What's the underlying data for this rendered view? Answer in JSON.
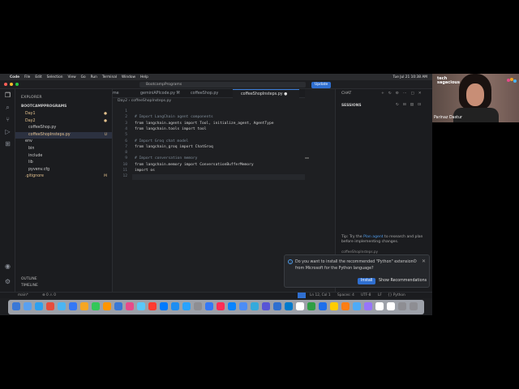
{
  "menubar": {
    "app": "Code",
    "items": [
      "File",
      "Edit",
      "Selection",
      "View",
      "Go",
      "Run",
      "Terminal",
      "Window",
      "Help"
    ],
    "clock": "Tue Jul 21 10:38 AM"
  },
  "titlebar": {
    "search": "BootcampPrograms",
    "update": "Update"
  },
  "explorer": {
    "title": "EXPLORER",
    "root": "BOOTCAMPPROGRAMS",
    "items": [
      {
        "label": "Day1",
        "badge": "●",
        "indent": 0
      },
      {
        "label": "Day2",
        "badge": "●",
        "indent": 0
      },
      {
        "label": "coffeeShop.py",
        "badge": "",
        "indent": 1
      },
      {
        "label": "coffeeShopInsteps.py",
        "badge": "U",
        "indent": 1
      },
      {
        "label": "env",
        "badge": "",
        "indent": 0
      },
      {
        "label": "bin",
        "badge": "",
        "indent": 1
      },
      {
        "label": "include",
        "badge": "",
        "indent": 1
      },
      {
        "label": "lib",
        "badge": "",
        "indent": 1
      },
      {
        "label": "pyvenv.cfg",
        "badge": "",
        "indent": 1
      },
      {
        "label": ".gitignore",
        "badge": "M",
        "indent": 0
      }
    ],
    "outline": "OUTLINE",
    "timeline": "TIMELINE"
  },
  "tabs": [
    {
      "label": "me",
      "active": false
    },
    {
      "label": "geminiAPIcode.py  M",
      "active": false
    },
    {
      "label": "coffeeShop.py",
      "active": false
    },
    {
      "label": "coffeeShopInsteps.py  ●",
      "active": true
    }
  ],
  "breadcrumb": "Day2 › coffeeShopInsteps.py",
  "code": [
    {
      "n": "1",
      "t": "",
      "c": "tx"
    },
    {
      "n": "2",
      "t": "# Import LangChain agent components",
      "c": "cm"
    },
    {
      "n": "3",
      "t": "from langchain.agents import Tool, initialize_agent, AgentType",
      "c": "tx"
    },
    {
      "n": "4",
      "t": "from langchain.tools import tool",
      "c": "tx"
    },
    {
      "n": "5",
      "t": "",
      "c": "tx"
    },
    {
      "n": "6",
      "t": "# Import Groq chat model",
      "c": "cm"
    },
    {
      "n": "7",
      "t": "from langchain_groq import ChatGroq",
      "c": "tx"
    },
    {
      "n": "8",
      "t": "",
      "c": "tx"
    },
    {
      "n": "9",
      "t": "# Import conversation memory",
      "c": "cm"
    },
    {
      "n": "10",
      "t": "from langchain.memory import ConversationBufferMemory",
      "c": "tx"
    },
    {
      "n": "11",
      "t": "import os",
      "c": "tx"
    },
    {
      "n": "12",
      "t": "",
      "c": "tx"
    }
  ],
  "chat": {
    "header": "CHAT",
    "sessions": "SESSIONS",
    "tip_prefix": "Tip: Try the ",
    "tip_link": "Plan agent",
    "tip_suffix": " to research and plan before implementing changes.",
    "file_chip": "coffeeShopInsteps.py"
  },
  "notification": {
    "message": "Do you want to install the recommended \"Python\" extension from Microsoft for the Python language?",
    "install": "Install",
    "show": "Show Recommendations"
  },
  "statusbar": {
    "branch": "main*",
    "errors": "⊗ 0 ⚠ 0",
    "position": "Ln 12, Col 1",
    "spaces": "Spaces: 4",
    "encoding": "UTF-8",
    "eol": "LF",
    "language": "{} Python"
  },
  "webcam": {
    "logo": "tech sagacious",
    "name": "Parinaz Dastur"
  },
  "colors": {
    "accent": "#2f6fd0",
    "editor_bg": "#1e1f22",
    "sidebar_bg": "#1b1c1f",
    "modified": "#e2c08d"
  },
  "dock_icon_colors": [
    "#3a78d6",
    "#5aa0f0",
    "#2ea0f0",
    "#e74c3c",
    "#4bb5f3",
    "#3478f6",
    "#f5a623",
    "#34c759",
    "#ff9500",
    "#3a78d6",
    "#e84a8a",
    "#5ac8fa",
    "#ff3b30",
    "#007aff",
    "#1f8ef1",
    "#29a3ff",
    "#8e8e93",
    "#3478f6",
    "#ff2d55",
    "#0a84ff",
    "#4c8df6",
    "#34aadc",
    "#5856d6",
    "#2f6fd0",
    "#007acc",
    "#ffffff",
    "#2f9e44",
    "#1f6feb",
    "#ffcc00",
    "#fd7e14",
    "#4dabf7",
    "#9775fa",
    "#ffffff",
    "#ffffff",
    "#8e8e93",
    "#8e8e93"
  ]
}
